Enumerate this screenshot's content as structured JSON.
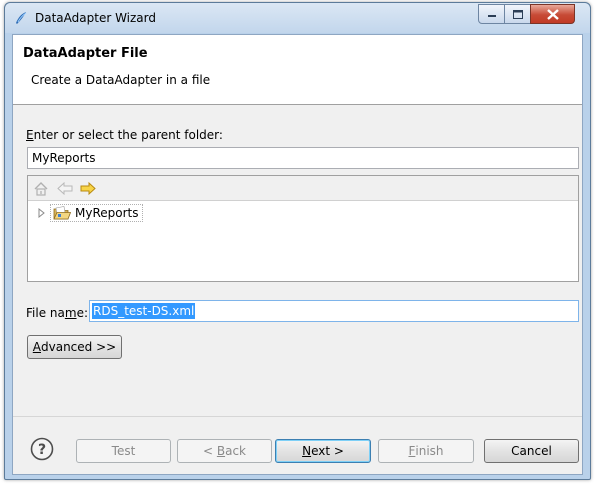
{
  "window": {
    "title": "DataAdapter Wizard",
    "accent_color": "#b9d1ea"
  },
  "header": {
    "title": "DataAdapter File",
    "description": "Create a DataAdapter in a file"
  },
  "parent_folder": {
    "label_access_key": "E",
    "label_rest": "nter or select the parent folder:",
    "value": "MyReports"
  },
  "tree": {
    "toolbar_icons": [
      "home-icon",
      "back-arrow-icon",
      "forward-arrow-icon"
    ],
    "items": [
      {
        "label": "MyReports",
        "icon": "open-folder-icon",
        "expanded": false
      }
    ]
  },
  "file_name": {
    "label_before": "File na",
    "label_access_key": "m",
    "label_after": "e:",
    "value": "RDS_test-DS.xml"
  },
  "advanced_button": {
    "access_key": "A",
    "rest": "dvanced >>"
  },
  "footer": {
    "help_icon": "help-icon",
    "test_label": "Test",
    "back_prefix": "< ",
    "back_access_key": "B",
    "back_rest": "ack",
    "next_prefix": "",
    "next_access_key": "N",
    "next_rest": "ext >",
    "finish_access_key": "F",
    "finish_rest": "inish",
    "cancel_label": "Cancel"
  }
}
